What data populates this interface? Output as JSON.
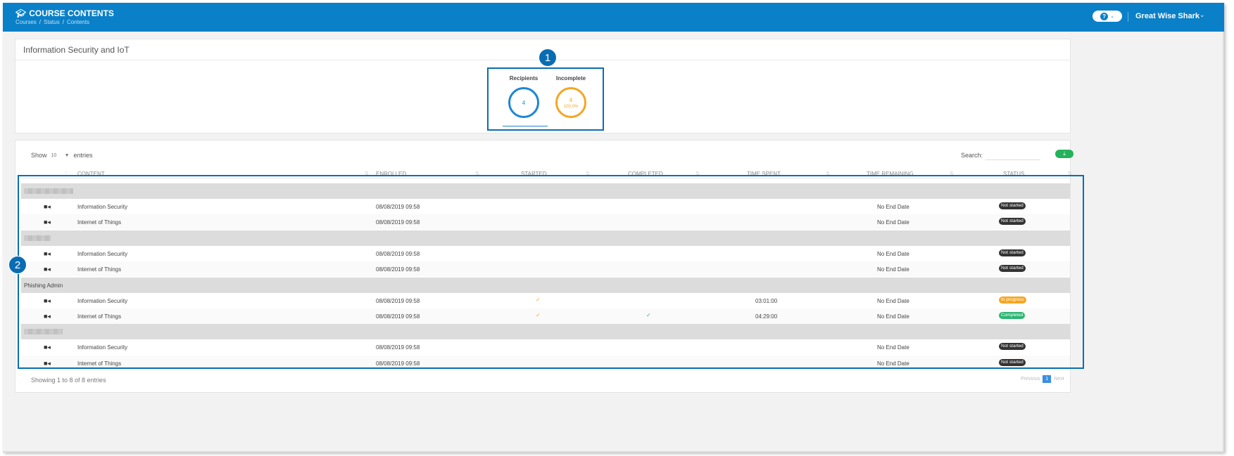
{
  "header": {
    "title": "COURSE CONTENTS",
    "breadcrumb": [
      "Courses",
      "Status",
      "Contents"
    ],
    "user": "Great Wise Shark"
  },
  "course": {
    "title": "Information Security and IoT",
    "stats": [
      {
        "label": "Recipients",
        "value": "4"
      },
      {
        "label": "Incomplete",
        "value": "4",
        "percent": "100.0%"
      }
    ]
  },
  "table": {
    "show_label": "Show",
    "page_size": "10",
    "entries_label": "entries",
    "search_label": "Search:",
    "columns": [
      "CONTENT",
      "ENROLLED",
      "STARTED",
      "COMPLETED",
      "TIME SPENT",
      "TIME REMAINING",
      "STATUS"
    ],
    "groups": [
      {
        "name": "",
        "rows": [
          {
            "content": "Information Security",
            "enrolled": "08/08/2019 09:58",
            "started": false,
            "completed": false,
            "time_spent": "",
            "time_remaining": "No End Date",
            "status": "Not started"
          },
          {
            "content": "Internet of Things",
            "enrolled": "08/08/2019 09:58",
            "started": false,
            "completed": false,
            "time_spent": "",
            "time_remaining": "No End Date",
            "status": "Not started"
          }
        ]
      },
      {
        "name": "",
        "rows": [
          {
            "content": "Information Security",
            "enrolled": "08/08/2019 09:58",
            "started": false,
            "completed": false,
            "time_spent": "",
            "time_remaining": "No End Date",
            "status": "Not started"
          },
          {
            "content": "Internet of Things",
            "enrolled": "08/08/2019 09:58",
            "started": false,
            "completed": false,
            "time_spent": "",
            "time_remaining": "No End Date",
            "status": "Not started"
          }
        ]
      },
      {
        "name": "Phishing Admin",
        "rows": [
          {
            "content": "Information Security",
            "enrolled": "08/08/2019 09:58",
            "started": true,
            "completed": false,
            "time_spent": "03:01:00",
            "time_remaining": "No End Date",
            "status": "In progress"
          },
          {
            "content": "Internet of Things",
            "enrolled": "08/08/2019 09:58",
            "started": true,
            "completed": true,
            "time_spent": "04:29:00",
            "time_remaining": "No End Date",
            "status": "Completed"
          }
        ]
      },
      {
        "name": "",
        "rows": [
          {
            "content": "Information Security",
            "enrolled": "08/08/2019 09:58",
            "started": false,
            "completed": false,
            "time_spent": "",
            "time_remaining": "No End Date",
            "status": "Not started"
          },
          {
            "content": "Internet of Things",
            "enrolled": "08/08/2019 09:58",
            "started": false,
            "completed": false,
            "time_spent": "",
            "time_remaining": "No End Date",
            "status": "Not started"
          }
        ]
      }
    ],
    "footer": "Showing 1 to 8 of 8 entries",
    "pager": {
      "previous": "Previous",
      "current": "1",
      "next": "Next"
    }
  },
  "callouts": [
    "1",
    "2"
  ],
  "colors": {
    "brand": "#0a80c8",
    "recipients": "#1e86d6",
    "incomplete": "#f5a623",
    "completed": "#2bb673",
    "not_started": "#333333"
  }
}
